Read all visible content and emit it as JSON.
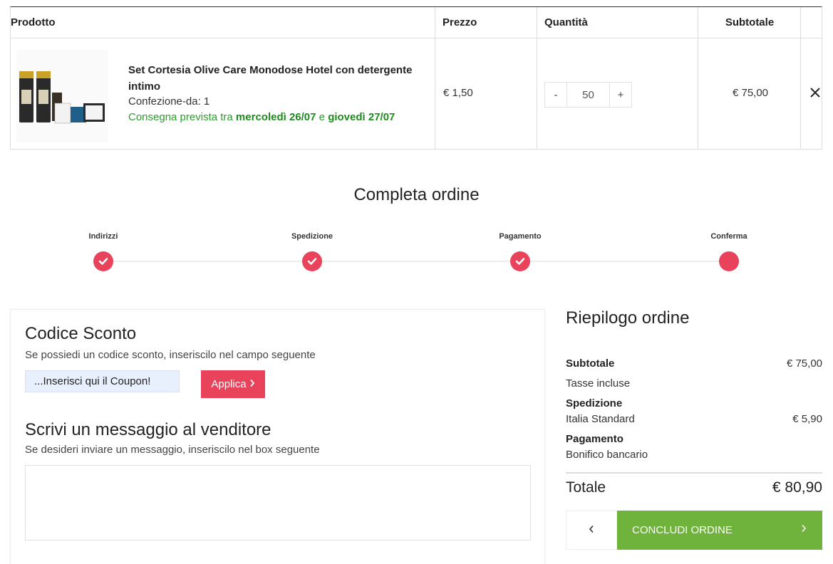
{
  "cart": {
    "headers": {
      "product": "Prodotto",
      "price": "Prezzo",
      "quantity": "Quantità",
      "subtotal": "Subtotale"
    },
    "item": {
      "name": "Set Cortesia Olive Care Monodose Hotel con detergente intimo",
      "package": "Confezione-da: 1",
      "delivery_prefix": "Consegna prevista tra ",
      "delivery_from": "mercoledì 26/07",
      "delivery_conj": " e ",
      "delivery_to": "giovedì 27/07",
      "price": "€ 1,50",
      "qty_minus": "-",
      "qty_value": "50",
      "qty_plus": "+",
      "subtotal": "€ 75,00",
      "image_icon": "product-photo-icon",
      "remove_icon": "close-icon"
    }
  },
  "checkout": {
    "title": "Completa ordine",
    "steps": [
      {
        "label": "Indirizzi",
        "done": true
      },
      {
        "label": "Spedizione",
        "done": true
      },
      {
        "label": "Pagamento",
        "done": true
      },
      {
        "label": "Conferma",
        "done": false
      }
    ]
  },
  "coupon": {
    "title": "Codice Sconto",
    "description": "Se possiedi un codice sconto, inseriscilo nel campo seguente",
    "input_value": "...Inserisci qui il Coupon!",
    "apply_label": "Applica"
  },
  "message": {
    "title": "Scrivi un messaggio al venditore",
    "description": "Se desideri inviare un messaggio, inseriscilo nel box seguente",
    "value": ""
  },
  "summary": {
    "title": "Riepilogo ordine",
    "subtotal_label": "Subtotale",
    "subtotal_value": "€ 75,00",
    "tax_note": "Tasse incluse",
    "shipping_label": "Spedizione",
    "shipping_method": "Italia Standard",
    "shipping_value": "€ 5,90",
    "payment_label": "Pagamento",
    "payment_method": "Bonifico bancario",
    "total_label": "Totale",
    "total_value": "€ 80,90",
    "confirm_label": "CONCLUDI ORDINE"
  },
  "colors": {
    "accent_red": "#e8435a",
    "confirm_green": "#6fb23c",
    "delivery_green": "#2f9a2f"
  }
}
